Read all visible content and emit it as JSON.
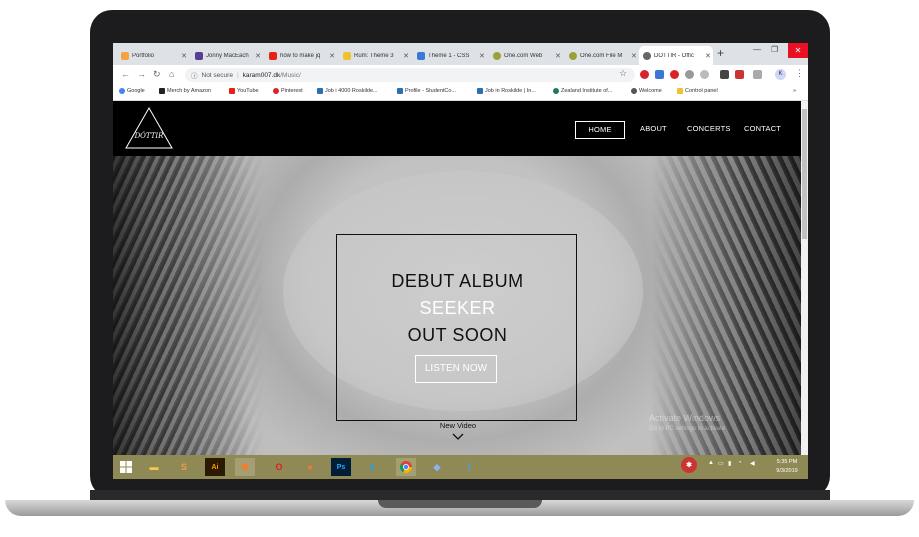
{
  "tabs": [
    {
      "label": "Portfolio",
      "color": "#f4a340"
    },
    {
      "label": "Jonny MacEach",
      "color": "#5b3e91"
    },
    {
      "label": "how to make jq",
      "color": "#e62117"
    },
    {
      "label": "Rum: Theme 3",
      "color": "#f2c12e"
    },
    {
      "label": "Theme 1 - CSS",
      "color": "#3a78d8"
    },
    {
      "label": "One.com Web",
      "color": "#9aa13a"
    },
    {
      "label": "One.com File M",
      "color": "#9aa13a"
    },
    {
      "label": "DÓTTIR - Offic",
      "color": "#666666"
    }
  ],
  "browser": {
    "new_tab": "+",
    "security": "Not secure",
    "url_host": "karam007.dk",
    "url_path": "/Music/",
    "profile_initial": "K"
  },
  "bookmarks": [
    {
      "label": "Google",
      "color": "#4285f4"
    },
    {
      "label": "Merch by Amazon",
      "color": "#222222"
    },
    {
      "label": "YouTube",
      "color": "#e62117"
    },
    {
      "label": "Pinterest",
      "color": "#d8232a"
    },
    {
      "label": "Job i 4000 Roskilde...",
      "color": "#2f6db5"
    },
    {
      "label": "Profile - StudentCo...",
      "color": "#2f6db5"
    },
    {
      "label": "Job in Roskilde | In...",
      "color": "#2f6db5"
    },
    {
      "label": "Zealand Institute of...",
      "color": "#1f7a5a"
    },
    {
      "label": "Welcome",
      "color": "#555555"
    },
    {
      "label": "Control panel",
      "color": "#f2c12e"
    }
  ],
  "site": {
    "logo_text": "DÓTTIR",
    "nav": {
      "home": "HOME",
      "about": "ABOUT",
      "concerts": "CONCERTS",
      "contact": "CONTACT"
    },
    "album_line1": "DEBUT ALBUM",
    "album_line2": "SEEKER",
    "album_line3": "OUT SOON",
    "listen_button": "LISTEN NOW",
    "new_video": "New Video"
  },
  "watermark": {
    "title": "Activate Windows",
    "subtitle": "Go to PC settings to activate"
  },
  "taskbar": {
    "apps": [
      "start-icon",
      "file-explorer-icon",
      "sublime-icon",
      "illustrator-icon",
      "xampp-icon",
      "opera-icon",
      "firefox-icon",
      "photoshop-icon",
      "ie-icon",
      "chrome-icon",
      "virtualbox-icon",
      "vscode-icon"
    ],
    "time": "5:35 PM",
    "date": "9/3/2019"
  }
}
